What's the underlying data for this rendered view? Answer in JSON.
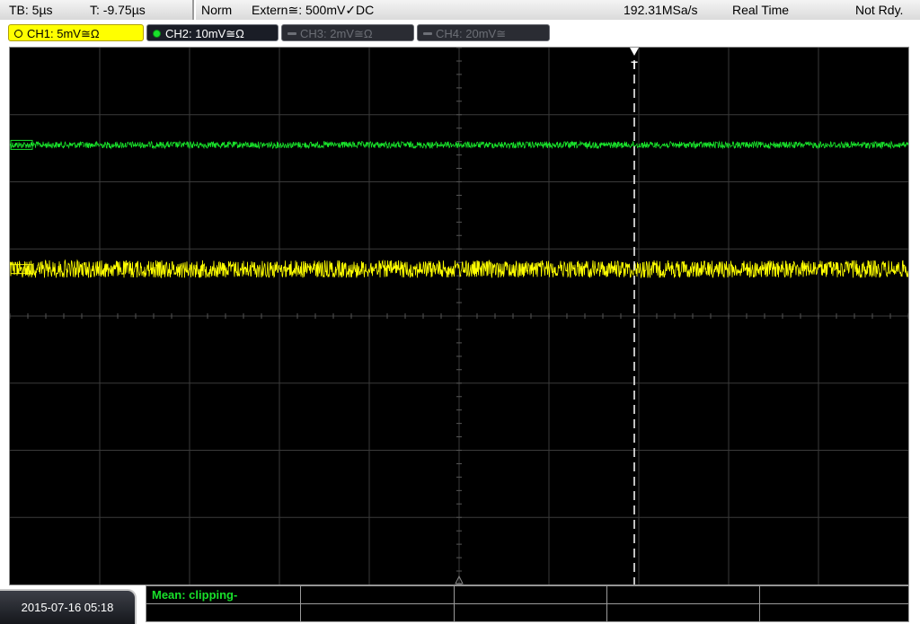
{
  "top_bar": {
    "timebase": "TB: 5µs",
    "trigger_time": "T: -9.75µs",
    "trigger_mode": "Norm",
    "trigger_source": "Extern≅: 500mV✓DC",
    "sample_rate": "192.31MSa/s",
    "acquisition_mode": "Real Time",
    "status": "Not Rdy."
  },
  "channels": [
    {
      "id": "ch1",
      "label": "CH1: 5mV≅Ω",
      "state": "active",
      "color": "#ffff00"
    },
    {
      "id": "ch2",
      "label": "CH2: 10mV≅Ω",
      "state": "on",
      "color": "#19e12b"
    },
    {
      "id": "ch3",
      "label": "CH3: 2mV≅Ω",
      "state": "off",
      "color": "#6c6f76"
    },
    {
      "id": "ch4",
      "label": "CH4: 20mV≅",
      "state": "off",
      "color": "#6c6f76"
    }
  ],
  "display": {
    "grid": "10 x 8 divisions",
    "background": "#000000",
    "grid_color": "#3a3a3a",
    "trigger_marker_label": "T",
    "traces": [
      {
        "channel": "ch2",
        "color": "#19e12b",
        "level_div_from_top": 1.45,
        "noise_div": 0.05
      },
      {
        "channel": "ch1",
        "color": "#ffff00",
        "level_div_from_top": 3.3,
        "noise_div": 0.13
      }
    ],
    "trigger_position_div": 6.95
  },
  "bottom": {
    "datetime": "2015-07-16 05:18",
    "measurement": "Mean: clipping-"
  }
}
